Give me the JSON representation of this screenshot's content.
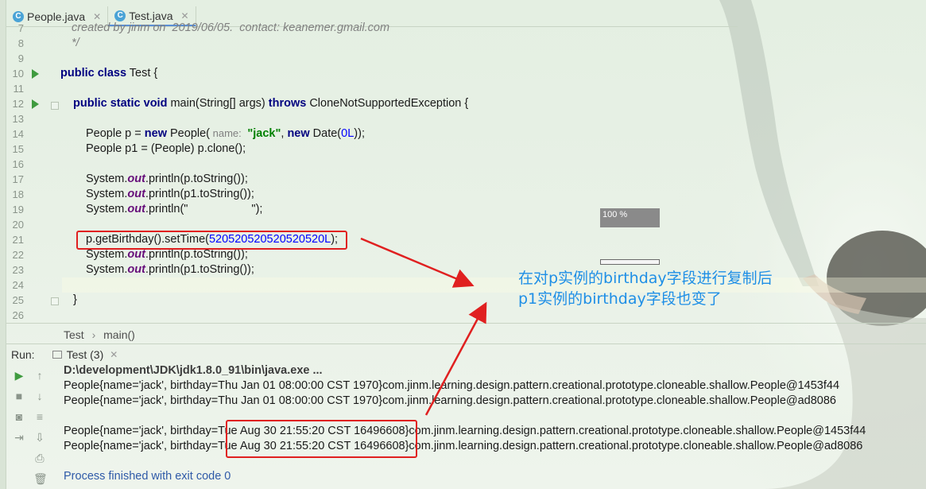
{
  "tabs": [
    {
      "label": "People.java",
      "icon": "class-icon"
    },
    {
      "label": "Test.java",
      "icon": "class-icon",
      "active": true
    }
  ],
  "editor": {
    "lines": [
      {
        "num": "8"
      },
      {
        "num": "9"
      },
      {
        "num": "10",
        "run": true
      },
      {
        "num": "11"
      },
      {
        "num": "12",
        "run": true
      },
      {
        "num": "13"
      },
      {
        "num": "14"
      },
      {
        "num": "15"
      },
      {
        "num": "16"
      },
      {
        "num": "17"
      },
      {
        "num": "18"
      },
      {
        "num": "19"
      },
      {
        "num": "20"
      },
      {
        "num": "21"
      },
      {
        "num": "22"
      },
      {
        "num": "23"
      },
      {
        "num": "24"
      },
      {
        "num": "25"
      },
      {
        "num": "26"
      }
    ],
    "comment_top": "created by jinm on  2019/06/05.  contact: keanemer.gmail.com",
    "comment_end": "*/",
    "class_decl": {
      "kw": "public class",
      "name": "Test {"
    },
    "main_decl": {
      "kw1": "public static void",
      "sig": "main(String[] args)",
      "kw2": "throws",
      "exc": "CloneNotSupportedException {"
    },
    "line14": {
      "a": "People p = ",
      "kw": "new",
      "b": " People(",
      "hint": " name: ",
      "str": "\"jack\"",
      "c": ", ",
      "kw2": "new",
      "d": " Date(",
      "num": "0L",
      "e": "));"
    },
    "line15": "People p1 = (People) p.clone();",
    "println_prefix": "System.",
    "println_out": "out",
    "line17_rest": ".println(p.toString());",
    "line18_rest": ".println(p1.toString());",
    "line19_rest": ".println(\"",
    "line19_str_end": "\");",
    "line21_a": "p.getBirthday().setTime(",
    "line21_num": "520520520520520520L",
    "line21_b": ");",
    "line22_rest": ".println(p.toString());",
    "line23_rest": ".println(p1.toString());",
    "close_brace": "}"
  },
  "breadcrumb": {
    "items": [
      "Test",
      "main()"
    ],
    "separator": "›"
  },
  "run_panel": {
    "label": "Run:",
    "tab": "Test (3)",
    "lines": [
      "D:\\development\\JDK\\jdk1.8.0_91\\bin\\java.exe ...",
      "People{name='jack', birthday=Thu Jan 01 08:00:00 CST 1970}com.jinm.learning.design.pattern.creational.prototype.cloneable.shallow.People@1453f44",
      "People{name='jack', birthday=Thu Jan 01 08:00:00 CST 1970}com.jinm.learning.design.pattern.creational.prototype.cloneable.shallow.People@ad8086",
      "",
      "People{name='jack', birthday=Tue Aug 30 21:55:20 CST 16496608}com.jinm.learning.design.pattern.creational.prototype.cloneable.shallow.People@1453f44",
      "People{name='jack', birthday=Tue Aug 30 21:55:20 CST 16496608}com.jinm.learning.design.pattern.creational.prototype.cloneable.shallow.People@ad8086",
      "",
      "Process finished with exit code 0"
    ]
  },
  "annotation": {
    "line1": "在对p实例的birthday字段进行复制后",
    "line2": "p1实例的birthday字段也变了"
  },
  "progress": {
    "label": "100 %",
    "value_percent": 100
  },
  "colors": {
    "accent": "#e02020",
    "annotation": "#1f8fe6",
    "keyword": "#000080",
    "string": "#008000",
    "number": "#0000ff"
  }
}
